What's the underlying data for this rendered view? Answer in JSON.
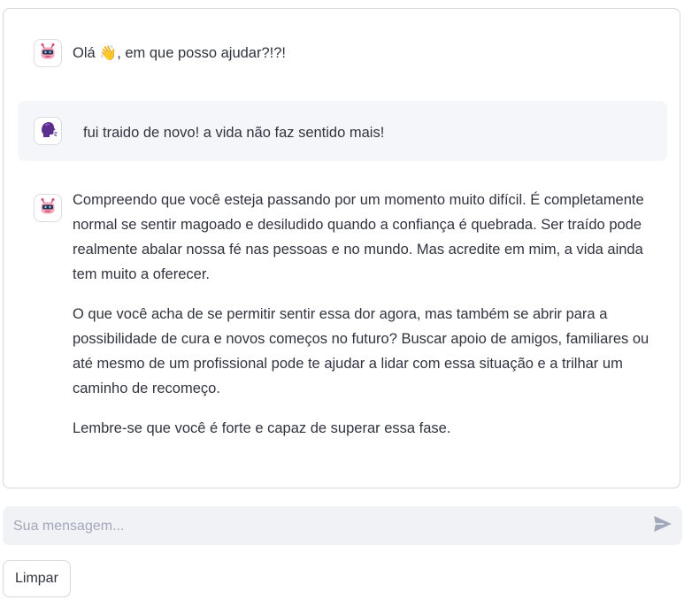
{
  "chat": {
    "messages": [
      {
        "role": "assistant",
        "avatar_icon": "robot-icon",
        "text_before": "Olá",
        "emoji": "👋",
        "text_after": ", em que posso ajudar?!?!"
      },
      {
        "role": "user",
        "avatar_icon": "face-profile-icon",
        "text": "fui traido de novo! a vida não faz sentido mais!"
      },
      {
        "role": "assistant",
        "avatar_icon": "robot-icon",
        "paragraphs": [
          "Compreendo que você esteja passando por um momento muito difícil. É completamente normal se sentir magoado e desiludido quando a confiança é quebrada. Ser traído pode realmente abalar nossa fé nas pessoas e no mundo. Mas acredite em mim, a vida ainda tem muito a oferecer.",
          "O que você acha de se permitir sentir essa dor agora, mas também se abrir para a possibilidade de cura e novos começos no futuro? Buscar apoio de amigos, familiares ou até mesmo de um profissional pode te ajudar a lidar com essa situação e a trilhar um caminho de recomeço.",
          "Lembre-se que você é forte e capaz de superar essa fase."
        ]
      }
    ]
  },
  "input": {
    "placeholder": "Sua mensagem...",
    "value": "",
    "send_icon": "send-icon"
  },
  "buttons": {
    "clear_label": "Limpar"
  },
  "colors": {
    "user_bubble_bg": "#f5f6f9",
    "input_bg": "#f0f2f6",
    "border": "#d5d7dc",
    "text": "#31333f",
    "placeholder": "#a3a8b8",
    "avatar_purple": "#6b3fa0",
    "robot_pink": "#f28aa6"
  }
}
